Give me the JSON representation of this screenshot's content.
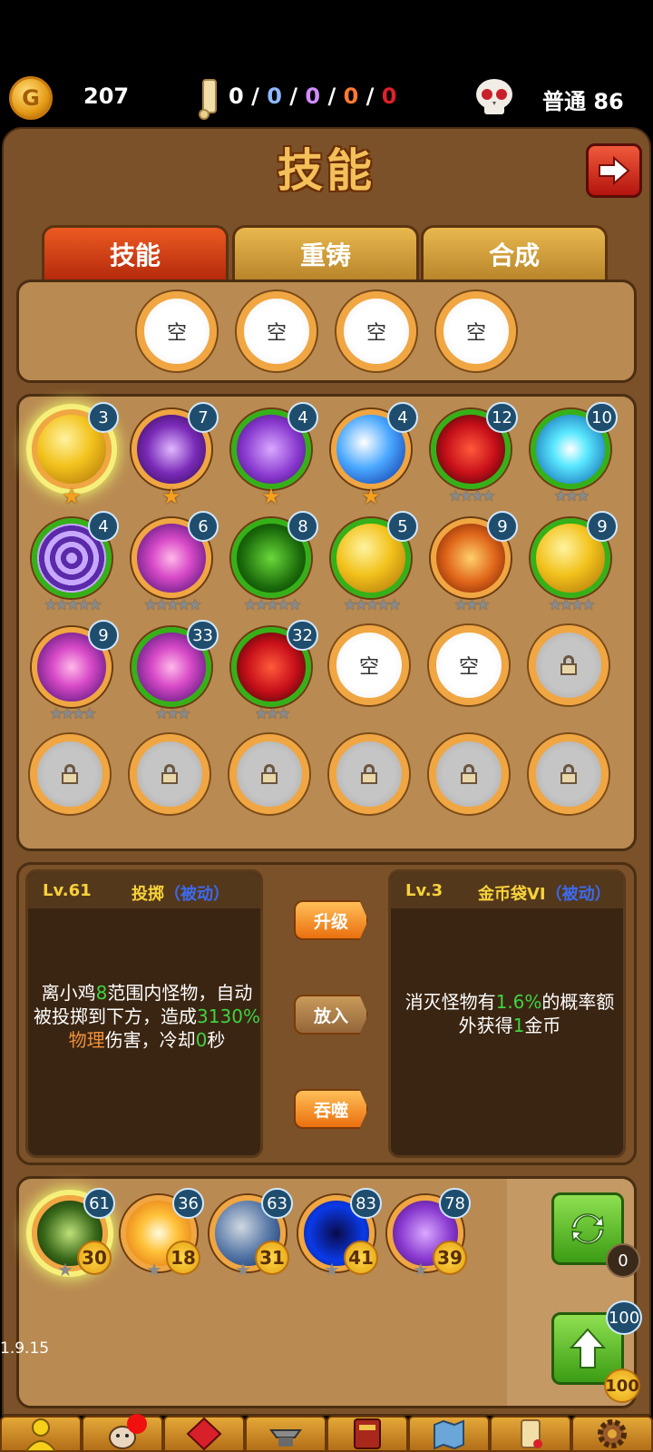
{
  "top": {
    "gold": "207",
    "coin_glyph": "G",
    "r0": "0",
    "r1": "0",
    "r2": "0",
    "r3": "0",
    "r4": "0",
    "sep": "/",
    "difficulty": "普通 86"
  },
  "title": "技能",
  "tabs": [
    "技能",
    "重铸",
    "合成"
  ],
  "empty_label": "空",
  "grid": [
    {
      "lv": "3",
      "ring": "o",
      "glow": true,
      "star": "gold",
      "stars": 1,
      "art": "gold"
    },
    {
      "lv": "7",
      "ring": "o",
      "star": "gold",
      "stars": 1,
      "art": "purple"
    },
    {
      "lv": "4",
      "ring": "g",
      "star": "gold",
      "stars": 1,
      "art": "violet"
    },
    {
      "lv": "4",
      "ring": "o",
      "star": "gold",
      "stars": 1,
      "art": "ice"
    },
    {
      "lv": "12",
      "ring": "g",
      "star": "grey",
      "stars": 4,
      "art": "red"
    },
    {
      "lv": "10",
      "ring": "g",
      "star": "grey",
      "stars": 3,
      "art": "cyan"
    },
    {
      "lv": "4",
      "ring": "g",
      "star": "grey",
      "stars": 5,
      "art": "vortex"
    },
    {
      "lv": "6",
      "ring": "o",
      "star": "grey",
      "stars": 5,
      "art": "pink"
    },
    {
      "lv": "8",
      "ring": "g",
      "star": "grey",
      "stars": 5,
      "art": "skull"
    },
    {
      "lv": "5",
      "ring": "g",
      "star": "grey",
      "stars": 5,
      "art": "gold"
    },
    {
      "lv": "9",
      "ring": "o",
      "star": "grey",
      "stars": 3,
      "art": "dragon"
    },
    {
      "lv": "9",
      "ring": "g",
      "star": "grey",
      "stars": 4,
      "art": "gold"
    },
    {
      "lv": "9",
      "ring": "o",
      "star": "grey",
      "stars": 4,
      "art": "pink"
    },
    {
      "lv": "33",
      "ring": "g",
      "star": "grey",
      "stars": 3,
      "art": "pink"
    },
    {
      "lv": "32",
      "ring": "g",
      "star": "grey",
      "stars": 3,
      "art": "red"
    }
  ],
  "left_info": {
    "lv": "Lv.61",
    "name": "投掷",
    "tag": "（被动）",
    "d1": "离小鸡",
    "d2": "8",
    "d3": "范围内怪物，自动被投掷到下方，造成",
    "d4": "3130%",
    "d5": "物理",
    "d6": "伤害，冷却",
    "d7": "0",
    "d8": "秒"
  },
  "right_info": {
    "lv": "Lv.3",
    "name": "金币袋VI",
    "tag": "（被动）",
    "d1": "消灭怪物有",
    "d2": "1.6%",
    "d3": "的概率额外获得",
    "d4": "1",
    "d5": "金币"
  },
  "actions": [
    "升级",
    "放入",
    "吞噬"
  ],
  "equipped": [
    {
      "badge": "61",
      "lvl": "30",
      "art": "green",
      "glow": true
    },
    {
      "badge": "36",
      "lvl": "18",
      "art": "sun"
    },
    {
      "badge": "63",
      "lvl": "31",
      "art": "rock"
    },
    {
      "badge": "83",
      "lvl": "41",
      "art": "blue"
    },
    {
      "badge": "78",
      "lvl": "39",
      "art": "violet"
    }
  ],
  "refresh_count": "0",
  "upgrade_top": "100",
  "upgrade_bottom": "100",
  "version": "1.9.15",
  "colors": {
    "panel": "#7b5129",
    "ring_orange": "#f0a642",
    "ring_green": "#36b019",
    "tab_active": "#d9461a"
  }
}
